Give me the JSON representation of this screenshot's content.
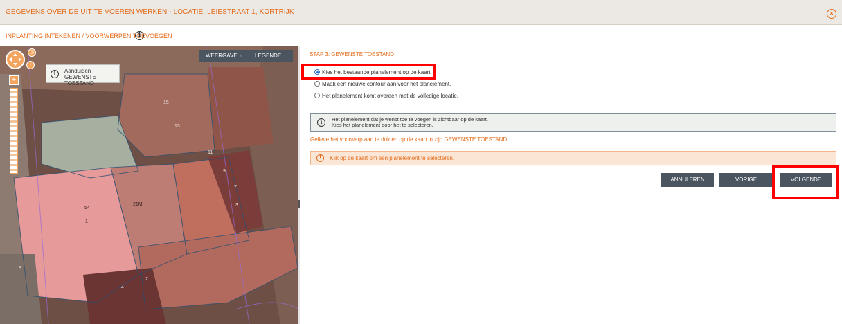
{
  "header": {
    "title": "GEGEVENS OVER DE UIT TE VOEREN WERKEN - LOCATIE: LEIESTRAAT 1, KORTRIJK",
    "close_icon": "close-circle-icon"
  },
  "subheader": {
    "label": "INPLANTING INTEKENEN / VOORWERPEN TOEVOEGEN",
    "info_icon": "info-icon"
  },
  "map": {
    "buttons": {
      "view": "WEERGAVE",
      "legend": "LEGENDE"
    },
    "tooltip": {
      "line1": "Aanduiden",
      "line2": "GEWENSTE TOESTAND"
    },
    "parcel_labels": [
      "15",
      "13",
      "11",
      "9",
      "7",
      "3",
      "54",
      "1",
      "21M",
      "4",
      "2",
      "3"
    ]
  },
  "panel": {
    "step_title": "STAP 3: GEWENSTE TOESTAND",
    "options": [
      {
        "label": "Kies het bestaande planelement op de kaart.",
        "selected": true
      },
      {
        "label": "Maak een nieuwe contour aan voor het planelement.",
        "selected": false
      },
      {
        "label": "Het planelement komt overeen met de volledige locatie.",
        "selected": false
      }
    ],
    "info": {
      "line1": "Het planelement dat je wenst toe te voegen is zichtbaar op de kaart.",
      "line2": "Kies het planelement door het te selecteren."
    },
    "hint": "Gelieve het voorwerp aan te dulden op de kaart in zijn GEWENSTE TOESTAND",
    "warning": "Klik op de kaart om een planelement te selecteren.",
    "buttons": {
      "cancel": "ANNULEREN",
      "previous": "VORIGE",
      "next": "VOLGENDE"
    }
  },
  "colors": {
    "accent": "#e36c1b",
    "button": "#4b5560",
    "highlight": "#ff0000",
    "selected_radio": "#2a6fc9"
  }
}
